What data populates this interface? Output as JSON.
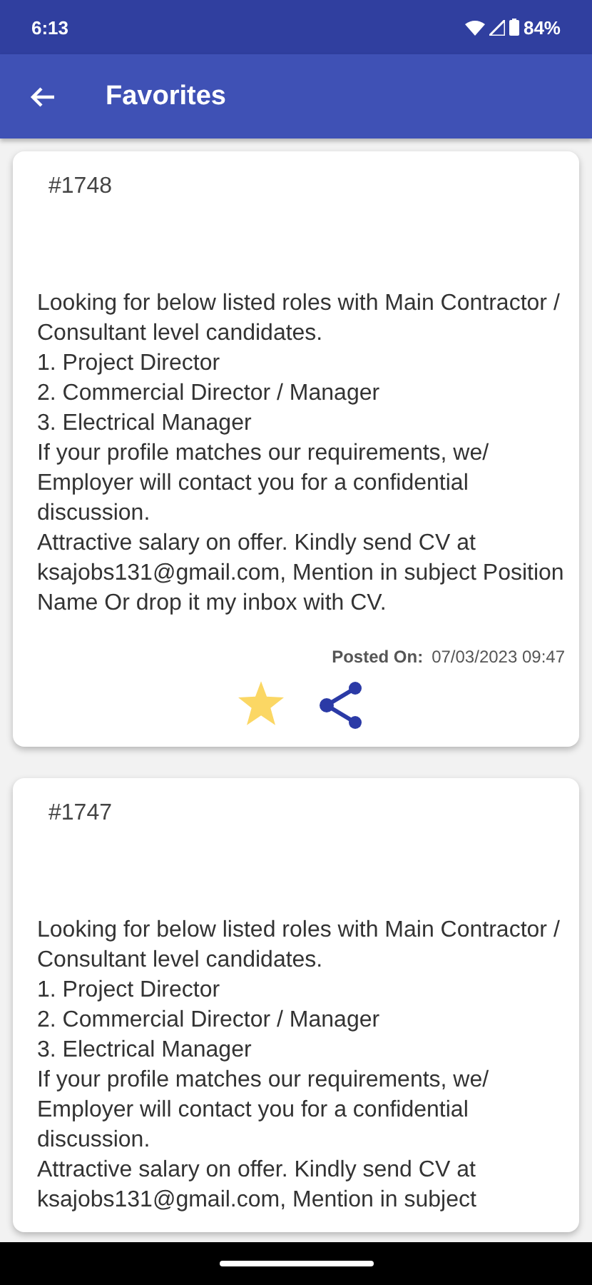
{
  "status_bar": {
    "time": "6:13",
    "battery": "84%"
  },
  "app_bar": {
    "title": "Favorites"
  },
  "posts": [
    {
      "number": "#1748",
      "lines": [
        " Looking for below listed roles with Main Contractor / Consultant level candidates.",
        "1. Project Director",
        "2. Commercial Director / Manager",
        "3. Electrical Manager",
        "If your profile matches our requirements, we/ Employer will contact you for a confidential discussion.",
        "Attractive salary on offer. Kindly send CV at ksajobs131@gmail.com, Mention in subject Position Name Or drop it my inbox with CV."
      ],
      "posted_label": "Posted On:",
      "posted_date": "07/03/2023 09:47",
      "favorite": true
    },
    {
      "number": "#1747",
      "lines": [
        " Looking for below listed roles with Main Contractor / Consultant level candidates.",
        "1. Project Director",
        "2. Commercial Director / Manager",
        "3. Electrical Manager",
        "If your profile matches our requirements, we/ Employer will contact you for a confidential discussion.",
        "Attractive salary on offer. Kindly send CV at ksajobs131@gmail.com, Mention in subject"
      ]
    }
  ]
}
